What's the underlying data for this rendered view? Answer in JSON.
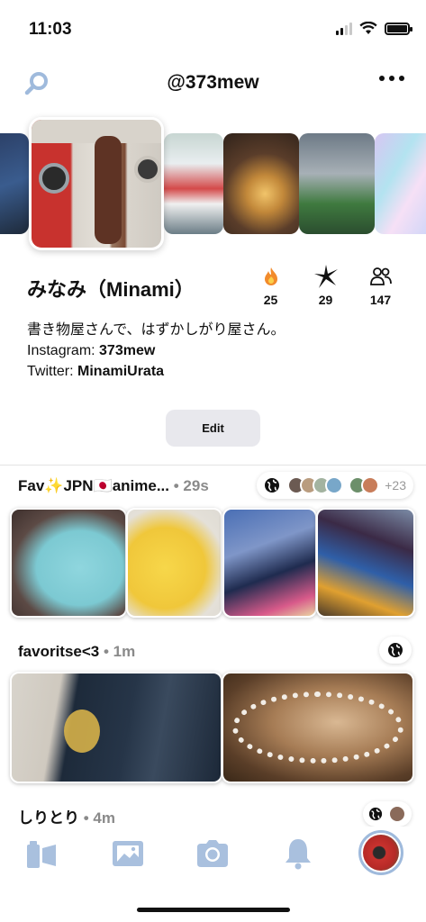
{
  "status_bar": {
    "time": "11:03"
  },
  "header": {
    "username": "@373mew"
  },
  "profile": {
    "name": "みなみ（Minami）",
    "stats": [
      {
        "icon": "fire-icon",
        "value": "25"
      },
      {
        "icon": "sparkle-icon",
        "value": "29"
      },
      {
        "icon": "people-icon",
        "value": "147"
      }
    ],
    "bio_line1": "書き物屋さんで、はずかしがり屋さん。",
    "instagram_label": "Instagram: ",
    "instagram_handle": "373mew",
    "twitter_label": "Twitter: ",
    "twitter_handle": "MinamiUrata",
    "edit_label": "Edit"
  },
  "albums": [
    {
      "title": "Fav✨JPN🇯🇵anime...",
      "ago": "• 29s",
      "extra_members": "+23"
    },
    {
      "title": "favoritse<3",
      "ago": "• 1m"
    },
    {
      "title": "しりとり",
      "ago": "• 4m"
    }
  ],
  "colors": {
    "accent": "#9fbadc",
    "tab_icon": "#a9c0de"
  }
}
